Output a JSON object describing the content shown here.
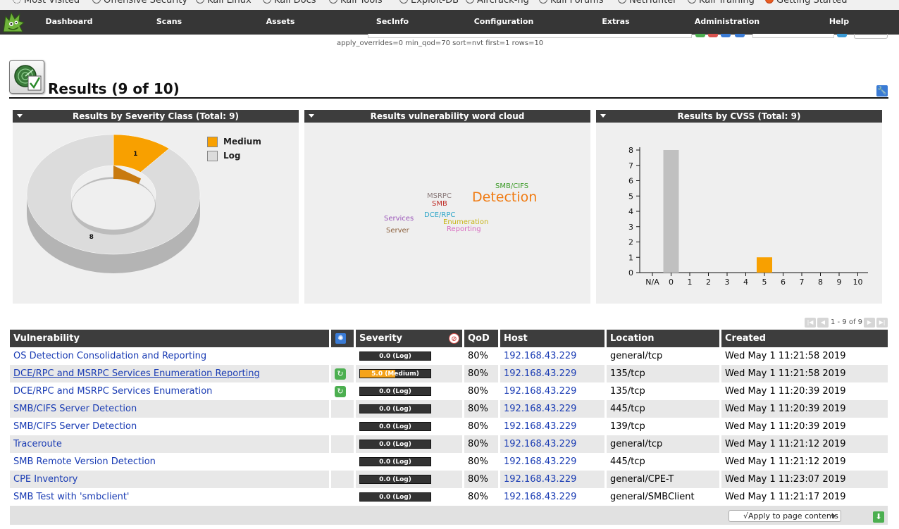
{
  "bookmarks": [
    {
      "label": "Most Visited",
      "icon": "gear-icon"
    },
    {
      "label": "Offensive Security",
      "icon": "globe-icon"
    },
    {
      "label": "Kali Linux",
      "icon": "globe-icon"
    },
    {
      "label": "Kali Docs",
      "icon": "globe-icon"
    },
    {
      "label": "Kali Tools",
      "icon": "globe-icon"
    },
    {
      "label": "Exploit-DB",
      "icon": "globe-icon"
    },
    {
      "label": "Aircrack-ng",
      "icon": "globe-icon"
    },
    {
      "label": "Kali Forums",
      "icon": "globe-icon"
    },
    {
      "label": "NetHunter",
      "icon": "globe-icon"
    },
    {
      "label": "Kali Training",
      "icon": "globe-icon"
    },
    {
      "label": "Getting Started",
      "icon": "firefox-icon"
    }
  ],
  "nav": {
    "items": [
      "Dashboard",
      "Scans",
      "Assets",
      "SecInfo",
      "Configuration",
      "Extras",
      "Administration",
      "Help"
    ]
  },
  "filter": {
    "text": "apply_overrides=0 min_qod=70 sort=nvt first=1 rows=10"
  },
  "header": {
    "title": "Results (9 of 10)"
  },
  "colors": {
    "medium": "#f8a000",
    "log": "#dcdcdc",
    "nav_bg": "#363636",
    "link": "#1a3cb4"
  },
  "chart_data": [
    {
      "type": "pie",
      "title": "Results by Severity Class (Total: 9)",
      "categories": [
        "Medium",
        "Log"
      ],
      "values": [
        1,
        8
      ],
      "legend": "top-right"
    },
    {
      "type": "wordcloud",
      "title": "Results vulnerability word cloud",
      "words": [
        {
          "text": "Detection",
          "color": "#f07a10"
        },
        {
          "text": "SMB/CIFS",
          "color": "#3a9a26"
        },
        {
          "text": "MSRPC",
          "color": "#8a7a7a"
        },
        {
          "text": "SMB",
          "color": "#c0302a"
        },
        {
          "text": "DCE/RPC",
          "color": "#2fa6c8"
        },
        {
          "text": "Services",
          "color": "#9a55b8"
        },
        {
          "text": "Enumeration",
          "color": "#c8b418"
        },
        {
          "text": "Server",
          "color": "#8a5e3a"
        },
        {
          "text": "Reporting",
          "color": "#d86cc0"
        }
      ]
    },
    {
      "type": "bar",
      "title": "Results by CVSS (Total: 9)",
      "categories": [
        "N/A",
        "0",
        "1",
        "2",
        "3",
        "4",
        "5",
        "6",
        "7",
        "8",
        "9",
        "10"
      ],
      "values": [
        0,
        8,
        0,
        0,
        0,
        0,
        1,
        0,
        0,
        0,
        0,
        0
      ],
      "bar_colors": [
        "#dcdcdc",
        "#c0c0c0",
        "#dcdcdc",
        "#dcdcdc",
        "#dcdcdc",
        "#dcdcdc",
        "#f8a000",
        "#dcdcdc",
        "#dcdcdc",
        "#dcdcdc",
        "#dcdcdc",
        "#dcdcdc"
      ],
      "y_ticks": [
        "0",
        "1",
        "2",
        "3",
        "4",
        "5",
        "6",
        "7",
        "8"
      ],
      "ylim": [
        0,
        8
      ]
    }
  ],
  "pagination": {
    "text": "1 - 9 of 9"
  },
  "table": {
    "columns": {
      "vulnerability": "Vulnerability",
      "severity": "Severity",
      "qod": "QoD",
      "host": "Host",
      "location": "Location",
      "created": "Created"
    },
    "rows": [
      {
        "vulnerability": "OS Detection Consolidation and Reporting",
        "override": false,
        "severity": "0.0 (Log)",
        "severity_value": 0.0,
        "qod": "80%",
        "host": "192.168.43.229",
        "location": "general/tcp",
        "created": "Wed May 1 11:21:58 2019"
      },
      {
        "vulnerability": "DCE/RPC and MSRPC Services Enumeration Reporting",
        "override": true,
        "severity": "5.0 (Medium)",
        "severity_value": 5.0,
        "qod": "80%",
        "host": "192.168.43.229",
        "location": "135/tcp",
        "created": "Wed May 1 11:21:58 2019"
      },
      {
        "vulnerability": "DCE/RPC and MSRPC Services Enumeration",
        "override": true,
        "severity": "0.0 (Log)",
        "severity_value": 0.0,
        "qod": "80%",
        "host": "192.168.43.229",
        "location": "135/tcp",
        "created": "Wed May 1 11:20:39 2019"
      },
      {
        "vulnerability": "SMB/CIFS Server Detection",
        "override": false,
        "severity": "0.0 (Log)",
        "severity_value": 0.0,
        "qod": "80%",
        "host": "192.168.43.229",
        "location": "445/tcp",
        "created": "Wed May 1 11:20:39 2019"
      },
      {
        "vulnerability": "SMB/CIFS Server Detection",
        "override": false,
        "severity": "0.0 (Log)",
        "severity_value": 0.0,
        "qod": "80%",
        "host": "192.168.43.229",
        "location": "139/tcp",
        "created": "Wed May 1 11:20:39 2019"
      },
      {
        "vulnerability": "Traceroute",
        "override": false,
        "severity": "0.0 (Log)",
        "severity_value": 0.0,
        "qod": "80%",
        "host": "192.168.43.229",
        "location": "general/tcp",
        "created": "Wed May 1 11:21:12 2019"
      },
      {
        "vulnerability": "SMB Remote Version Detection",
        "override": false,
        "severity": "0.0 (Log)",
        "severity_value": 0.0,
        "qod": "80%",
        "host": "192.168.43.229",
        "location": "445/tcp",
        "created": "Wed May 1 11:21:12 2019"
      },
      {
        "vulnerability": "CPE Inventory",
        "override": false,
        "severity": "0.0 (Log)",
        "severity_value": 0.0,
        "qod": "80%",
        "host": "192.168.43.229",
        "location": "general/CPE-T",
        "created": "Wed May 1 11:23:07 2019"
      },
      {
        "vulnerability": "SMB Test with 'smbclient'",
        "override": false,
        "severity": "0.0 (Log)",
        "severity_value": 0.0,
        "qod": "80%",
        "host": "192.168.43.229",
        "location": "general/SMBClient",
        "created": "Wed May 1 11:21:17 2019"
      }
    ]
  },
  "footer": {
    "apply_label": "√Apply to page contents"
  }
}
